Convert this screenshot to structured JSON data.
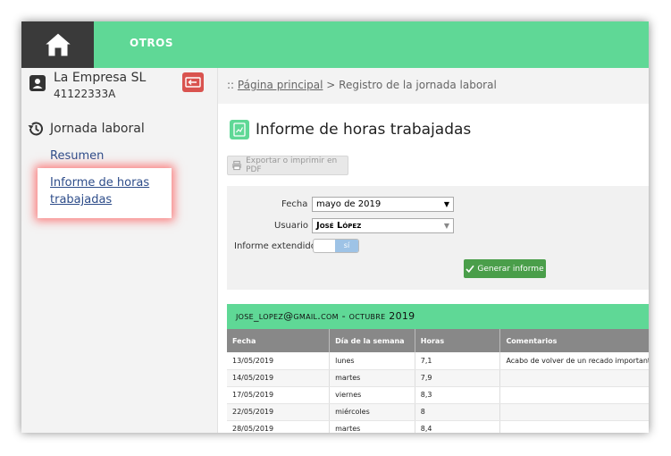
{
  "topbar": {
    "nav_label": "OTROS"
  },
  "sidebar": {
    "company_name": "La Empresa SL",
    "company_id": "41122333A",
    "section_title": "Jornada laboral",
    "items": [
      {
        "label": "Resumen"
      },
      {
        "label": "Informe de horas trabajadas"
      }
    ]
  },
  "breadcrumb": {
    "prefix": "::",
    "home": "Página principal",
    "separator": ">",
    "current": "Registro de la jornada laboral"
  },
  "main": {
    "title": "Informe de horas trabajadas",
    "pdf_button": "Exportar o imprimir en PDF",
    "filters": {
      "fecha_label": "Fecha",
      "fecha_value": "mayo de 2019",
      "usuario_label": "Usuario",
      "usuario_value": "José López",
      "extendido_label": "Informe extendido",
      "extendido_value": "sí",
      "generate_button": "Generar informe"
    },
    "report": {
      "header": "jose_lopez@gmail.com - octubre 2019",
      "columns": [
        "Fecha",
        "Día de la semana",
        "Horas",
        "Comentarios"
      ],
      "rows": [
        [
          "13/05/2019",
          "lunes",
          "7,1",
          "Acabo de volver de un recado importante"
        ],
        [
          "14/05/2019",
          "martes",
          "7,9",
          ""
        ],
        [
          "17/05/2019",
          "viernes",
          "8,3",
          ""
        ],
        [
          "22/05/2019",
          "miércoles",
          "8",
          ""
        ],
        [
          "28/05/2019",
          "martes",
          "8,4",
          ""
        ]
      ]
    }
  },
  "colors": {
    "accent": "#5fd896",
    "dark": "#3a3a3a",
    "danger": "#d9534f",
    "success": "#4a9e4a",
    "link": "#2e4d8a"
  }
}
